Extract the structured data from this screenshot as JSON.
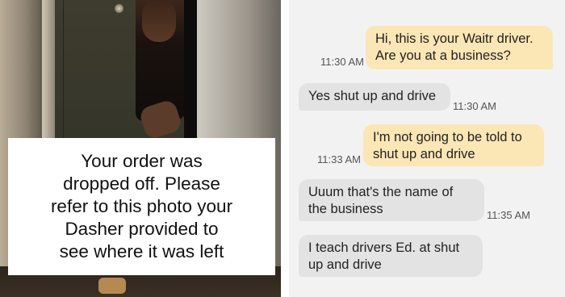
{
  "photo": {
    "caption_lines": [
      "Your order was",
      "dropped off. Please",
      "refer to this photo your",
      "Dasher provided to",
      "see where it was left"
    ]
  },
  "chat": {
    "messages": [
      {
        "direction": "outgoing",
        "lines": [
          "Hi, this is your Waitr driver.",
          "Are you at a business?"
        ],
        "time": "11:30 AM"
      },
      {
        "direction": "incoming",
        "lines": [
          "Yes shut up and drive"
        ],
        "time": "11:30 AM"
      },
      {
        "direction": "outgoing",
        "lines": [
          "I'm not going to be told to",
          "shut up and drive"
        ],
        "time": "11:33 AM"
      },
      {
        "direction": "incoming",
        "lines": [
          "Uuum that's the name of",
          "the business"
        ],
        "time": "11:35 AM"
      },
      {
        "direction": "incoming",
        "lines": [
          "I teach drivers Ed. at shut",
          "up and drive"
        ],
        "time": ""
      }
    ]
  },
  "colors": {
    "outgoing_bubble": "#fbe6b5",
    "incoming_bubble": "#e3e3e3",
    "chat_background": "#f2f2f2"
  }
}
